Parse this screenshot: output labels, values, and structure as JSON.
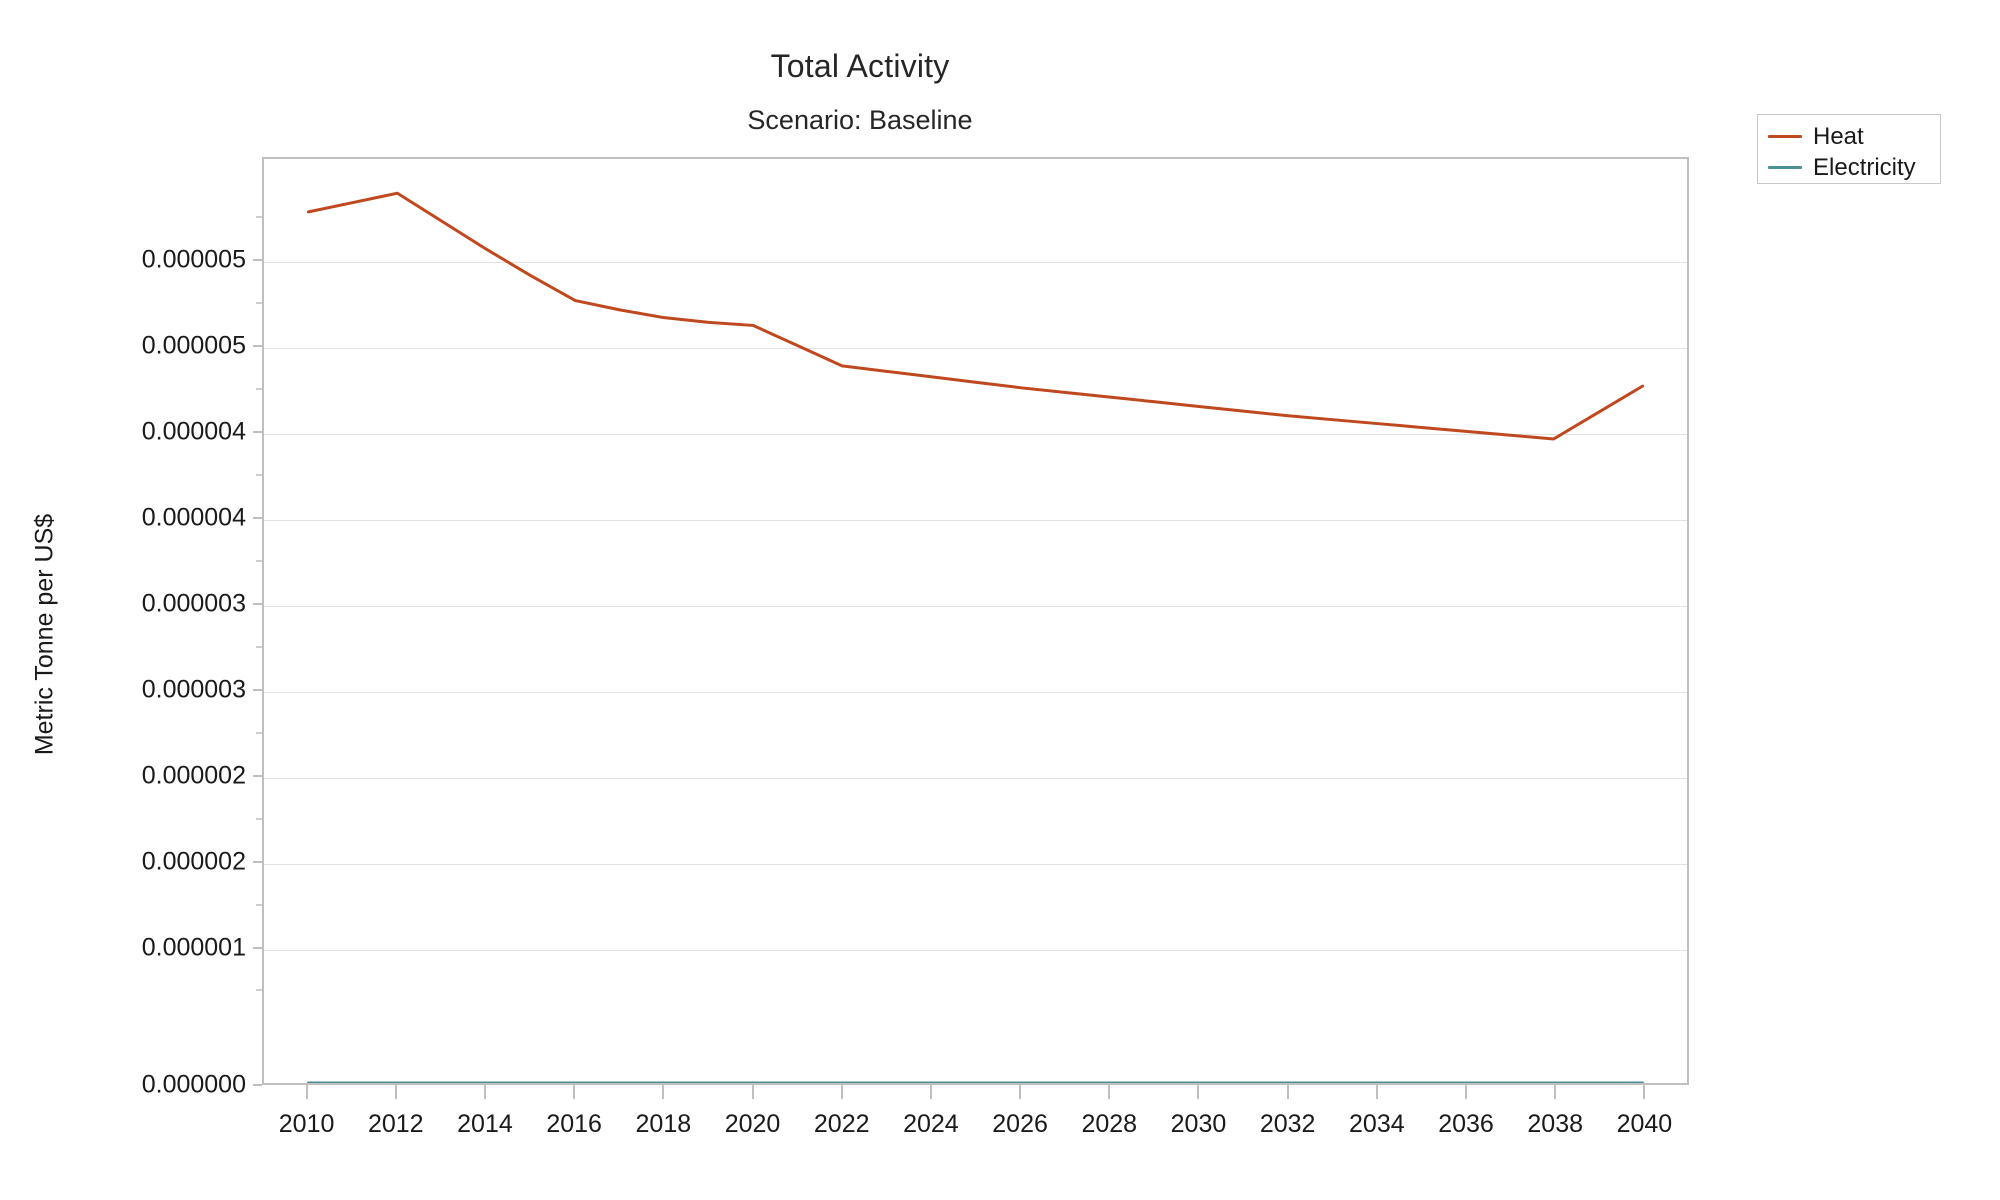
{
  "chart_data": {
    "type": "line",
    "title": "Total Activity",
    "subtitle": "Scenario: Baseline",
    "xlabel": "",
    "ylabel": "Metric Tonne  per US$",
    "grid": true,
    "legend_position": "top-right-outside",
    "xlim": [
      2009,
      2041
    ],
    "ylim": [
      0,
      5.94e-06
    ],
    "x_tick_labels": [
      "2010",
      "2012",
      "2014",
      "2016",
      "2018",
      "2020",
      "2022",
      "2024",
      "2026",
      "2028",
      "2030",
      "2032",
      "2034",
      "2036",
      "2038",
      "2040"
    ],
    "x_ticks": [
      2010,
      2012,
      2014,
      2016,
      2018,
      2020,
      2022,
      2024,
      2026,
      2028,
      2030,
      2032,
      2034,
      2036,
      2038,
      2040
    ],
    "y_tick_labels": [
      "0.000005",
      "0.000005",
      "0.000004",
      "0.000004",
      "0.000003",
      "0.000003",
      "0.000002",
      "0.000002",
      "0.000001",
      "0.000000"
    ],
    "y_ticks": [
      5.28e-06,
      4.73e-06,
      4.18e-06,
      3.63e-06,
      3.08e-06,
      2.53e-06,
      1.98e-06,
      1.43e-06,
      8.8e-07,
      0.0
    ],
    "x": [
      2010,
      2011,
      2012,
      2013,
      2014,
      2015,
      2016,
      2017,
      2018,
      2019,
      2020,
      2021,
      2022,
      2023,
      2024,
      2025,
      2026,
      2027,
      2028,
      2029,
      2030,
      2031,
      2032,
      2033,
      2034,
      2035,
      2036,
      2037,
      2038,
      2039,
      2040
    ],
    "series": [
      {
        "name": "Heat",
        "color": "#c0481f",
        "values": [
          5.6e-06,
          5.66e-06,
          5.72e-06,
          5.54e-06,
          5.36e-06,
          5.19e-06,
          5.03e-06,
          4.97e-06,
          4.92e-06,
          4.89e-06,
          4.87e-06,
          4.74e-06,
          4.61e-06,
          4.575e-06,
          4.54e-06,
          4.505e-06,
          4.47e-06,
          4.44e-06,
          4.41e-06,
          4.38e-06,
          4.35e-06,
          4.32e-06,
          4.29e-06,
          4.265e-06,
          4.24e-06,
          4.215e-06,
          4.19e-06,
          4.165e-06,
          4.14e-06,
          4.31e-06,
          4.48e-06
        ]
      },
      {
        "name": "Electricity",
        "color": "#4a9094",
        "values": [
          0,
          0,
          0,
          0,
          0,
          0,
          0,
          0,
          0,
          0,
          0,
          0,
          0,
          0,
          0,
          0,
          0,
          0,
          0,
          0,
          0,
          0,
          0,
          0,
          0,
          0,
          0,
          0,
          0,
          0,
          0
        ]
      }
    ]
  },
  "legend": {
    "items": [
      {
        "label": "Heat",
        "color": "#c0481f"
      },
      {
        "label": "Electricity",
        "color": "#4a9094"
      }
    ]
  }
}
